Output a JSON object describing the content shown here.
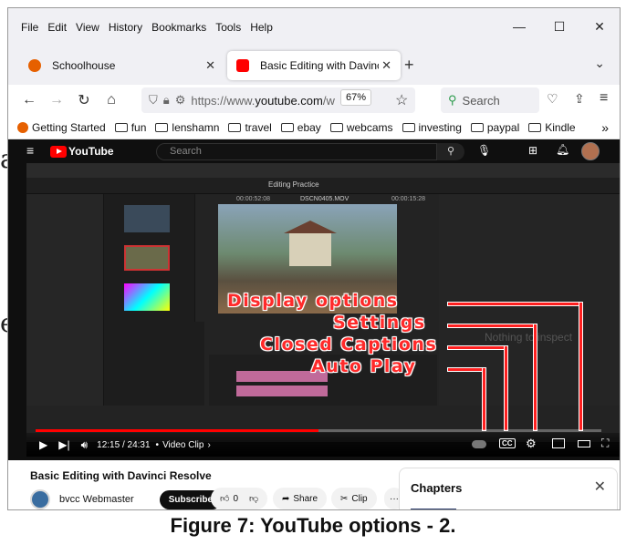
{
  "menubar": {
    "items": [
      "File",
      "Edit",
      "View",
      "History",
      "Bookmarks",
      "Tools",
      "Help"
    ]
  },
  "window_controls": {
    "minimize": "—",
    "maximize": "☐",
    "close": "✕"
  },
  "tabs": [
    {
      "title": "Schoolhouse",
      "favicon_color": "#e66000"
    },
    {
      "title": "Basic Editing with Davinci Resc",
      "favicon_color": "#ff0000"
    }
  ],
  "new_tab": "+",
  "tab_overflow": "⌄",
  "toolbar": {
    "url_prefix": "https://www.",
    "url_domain": "youtube.com",
    "url_suffix": "/w",
    "zoom": "67%",
    "search_placeholder": "Search"
  },
  "bookmarks": [
    "Getting Started",
    "fun",
    "lenshamn",
    "travel",
    "ebay",
    "webcams",
    "investing",
    "paypal",
    "Kindle"
  ],
  "bookmarks_overflow": "»",
  "youtube": {
    "logo": "YouTube",
    "search_placeholder": "Search",
    "video": {
      "resolve_title": "Editing Practice",
      "clip_name": "DSCN0405.MOV",
      "timecode_left": "00:00:52:08",
      "timecode_right": "00:00:15:28",
      "nothing_to_inspect": "Nothing to inspect",
      "callouts": [
        "Display options",
        "Settings",
        "Closed Captions",
        "Auto Play"
      ]
    },
    "controls": {
      "time": "12:15 / 24:31",
      "chapter": "Video Clip",
      "progress": 0.5
    },
    "below": {
      "title": "Basic Editing with Davinci Resolve",
      "channel": "bvcc Webmaster",
      "subscribe": "Subscribe",
      "likes": "0",
      "share": "Share",
      "clip": "Clip",
      "more": "···",
      "chapters_heading": "Chapters",
      "chapters_close": "✕"
    }
  },
  "figure_caption": "Figure 7: YouTube options - 2."
}
